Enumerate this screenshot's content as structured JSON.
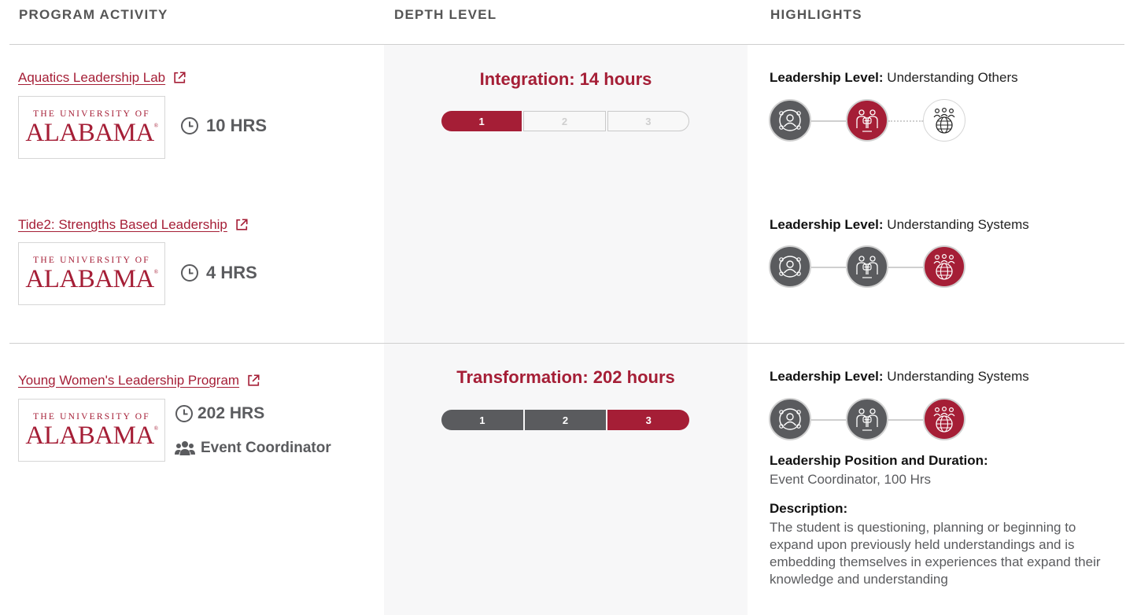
{
  "header": {
    "col_activity": "PROGRAM ACTIVITY",
    "col_depth": "DEPTH LEVEL",
    "col_highlights": "HIGHLIGHTS"
  },
  "logo": {
    "line1": "THE UNIVERSITY OF",
    "line2": "ALABAMA",
    "mark": "®"
  },
  "colors": {
    "accent": "#a51e36",
    "grey": "#5a5b5e",
    "divider": "#cfcfcf",
    "depth_bg": "#f7f7f8"
  },
  "icons": {
    "external": "external-link-icon",
    "clock": "clock-icon",
    "users": "users-icon",
    "level1": "person-circle-icon",
    "level2": "group-people-icon",
    "level3": "globe-people-icon"
  },
  "group1": {
    "depth_title": "Integration: 14 hours",
    "depth_segments": [
      "1",
      "2",
      "3"
    ],
    "activities": [
      {
        "title": "Aquatics Leadership Lab",
        "hours": "10 HRS",
        "level_label": "Leadership Level:",
        "level_value": "Understanding Others"
      },
      {
        "title": "Tide2: Strengths Based Leadership",
        "hours": "4 HRS",
        "level_label": "Leadership Level:",
        "level_value": "Understanding Systems"
      }
    ]
  },
  "group2": {
    "depth_title": "Transformation: 202 hours",
    "depth_segments": [
      "1",
      "2",
      "3"
    ],
    "activity": {
      "title": "Young Women's Leadership Program",
      "hours": "202 HRS",
      "role": "Event Coordinator",
      "level_label": "Leadership Level:",
      "level_value": "Understanding Systems",
      "position_label": "Leadership Position and Duration:",
      "position_value": "Event Coordinator, 100 Hrs",
      "description_label": "Description:",
      "description_value": "The student is questioning, planning or beginning to expand upon previously held understandings and is embedding themselves in experiences that expand their knowledge and understanding"
    }
  }
}
